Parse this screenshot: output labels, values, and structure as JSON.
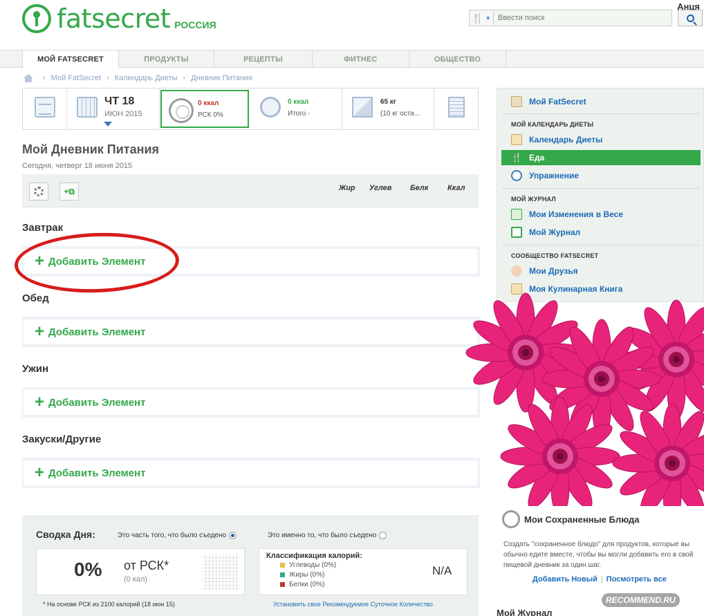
{
  "brand": {
    "name": "fatsecret",
    "region": "РОССИЯ",
    "color": "#34a84a"
  },
  "user": {
    "name": "Анця"
  },
  "search": {
    "placeholder": "Ввести поиск"
  },
  "nav": {
    "tabs": [
      {
        "label": "МОЙ FATSECRET"
      },
      {
        "label": "ПРОДУКТЫ"
      },
      {
        "label": "РЕЦЕПТЫ"
      },
      {
        "label": "ФИТНЕС"
      },
      {
        "label": "ОБЩЕСТВО"
      }
    ]
  },
  "breadcrumb": [
    "Мой FatSecret",
    "Календарь Диеты",
    "Дневник Питания"
  ],
  "strip": {
    "date_day": "ЧТ 18",
    "date_month": "ИЮН 2015",
    "food_kcal": "0 ккал",
    "food_rsk": "РСК 0%",
    "exercise_kcal": "0 ккал",
    "exercise_total": "Итого -",
    "weight": "65 кг",
    "weight_left": "(10 кг оста..."
  },
  "main": {
    "title": "Мой Дневник Питания",
    "date": "Сегодня, четверг 18 июня 2015",
    "columns": [
      "Жир",
      "Углев",
      "Белк",
      "Ккал"
    ],
    "add_label": "Добавить Элемент",
    "meals": [
      "Завтрак",
      "Обед",
      "Ужин",
      "Закуски/Другие"
    ]
  },
  "day_summary": {
    "title": "Сводка Дня:",
    "option_eaten_part": "Это часть того, что было съедено",
    "option_eaten_exact": "Это именно то, что было съедено",
    "percent": "0%",
    "of_rsk": "от РСК*",
    "kal": "(0 кал)",
    "classification_title": "Классификация калорий:",
    "carbs": "Углеводы (0%)",
    "fat": "Жиры (0%)",
    "protein": "Белки (0%)",
    "na": "N/A",
    "footnote": "* На основе РСК из 2100 калорий (18 июн 15)",
    "set_link": "Установить свое Рекомендуемое Суточное Количество"
  },
  "sidebar": {
    "top_item": "Мой FatSecret",
    "section_calendar": "МОЙ КАЛЕНДАРЬ ДИЕТЫ",
    "calendar_items": [
      "Календарь Диеты",
      "Еда",
      "Упражнение"
    ],
    "section_journal": "МОЙ ЖУРНАЛ",
    "journal_items": [
      "Мои Изменения в Весе",
      "Мой Журнал"
    ],
    "section_community": "СООБЩЕСТВО FATSECRET",
    "community_items": [
      "Мои Друзья",
      "Моя Кулинарная Книга"
    ]
  },
  "saved_meals": {
    "title": "Мои Сохраненные Блюда",
    "text": "Создать \"сохраненное блюдо\" для продуктов, которые вы обычно едите вместе, чтобы вы могли добавить его в свой пищевой дневник за один шаг.",
    "add_new": "Добавить Новый",
    "view_all": "Посмотреть все"
  },
  "bottom_heading": "Мой Журнал",
  "watermark": "RECOMMEND.RU"
}
